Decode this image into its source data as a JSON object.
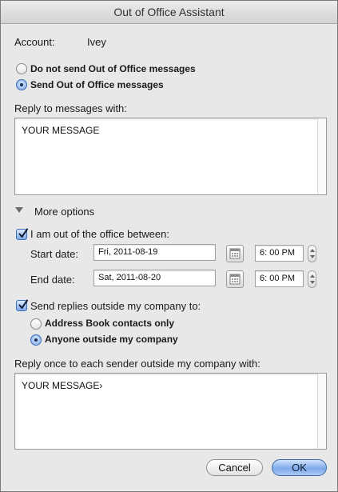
{
  "window": {
    "title": "Out of Office Assistant"
  },
  "account": {
    "label": "Account:",
    "value": "Ivey"
  },
  "mode": {
    "options": [
      {
        "label": "Do not send Out of Office messages",
        "selected": false
      },
      {
        "label": "Send Out of Office messages",
        "selected": true
      }
    ]
  },
  "reply": {
    "label": "Reply to messages with:",
    "text": "YOUR MESSAGE"
  },
  "more_options": {
    "label": "More options",
    "expanded": true
  },
  "out_of_office": {
    "checkbox_label": "I am out of the office between:",
    "checked": true,
    "start": {
      "label": "Start date:",
      "date": "Fri, 2011-08-19",
      "time": "6: 00 PM"
    },
    "end": {
      "label": "End date:",
      "date": "Sat, 2011-08-20",
      "time": "6: 00 PM"
    }
  },
  "outside": {
    "checkbox_label": "Send replies outside my company to:",
    "checked": true,
    "options": [
      {
        "label": "Address Book contacts only",
        "selected": false
      },
      {
        "label": "Anyone outside my company",
        "selected": true
      }
    ]
  },
  "outside_reply": {
    "label": "Reply once to each sender outside my company with:",
    "text": "YOUR MESSAGE›"
  },
  "buttons": {
    "cancel": "Cancel",
    "ok": "OK"
  },
  "colors": {
    "accent": "#6f9fe6",
    "window_bg": "#e8e8e8"
  },
  "icons": {
    "calendar": "calendar-icon",
    "checkmark": "checkmark-icon",
    "disclosure": "disclosure-triangle-icon"
  }
}
